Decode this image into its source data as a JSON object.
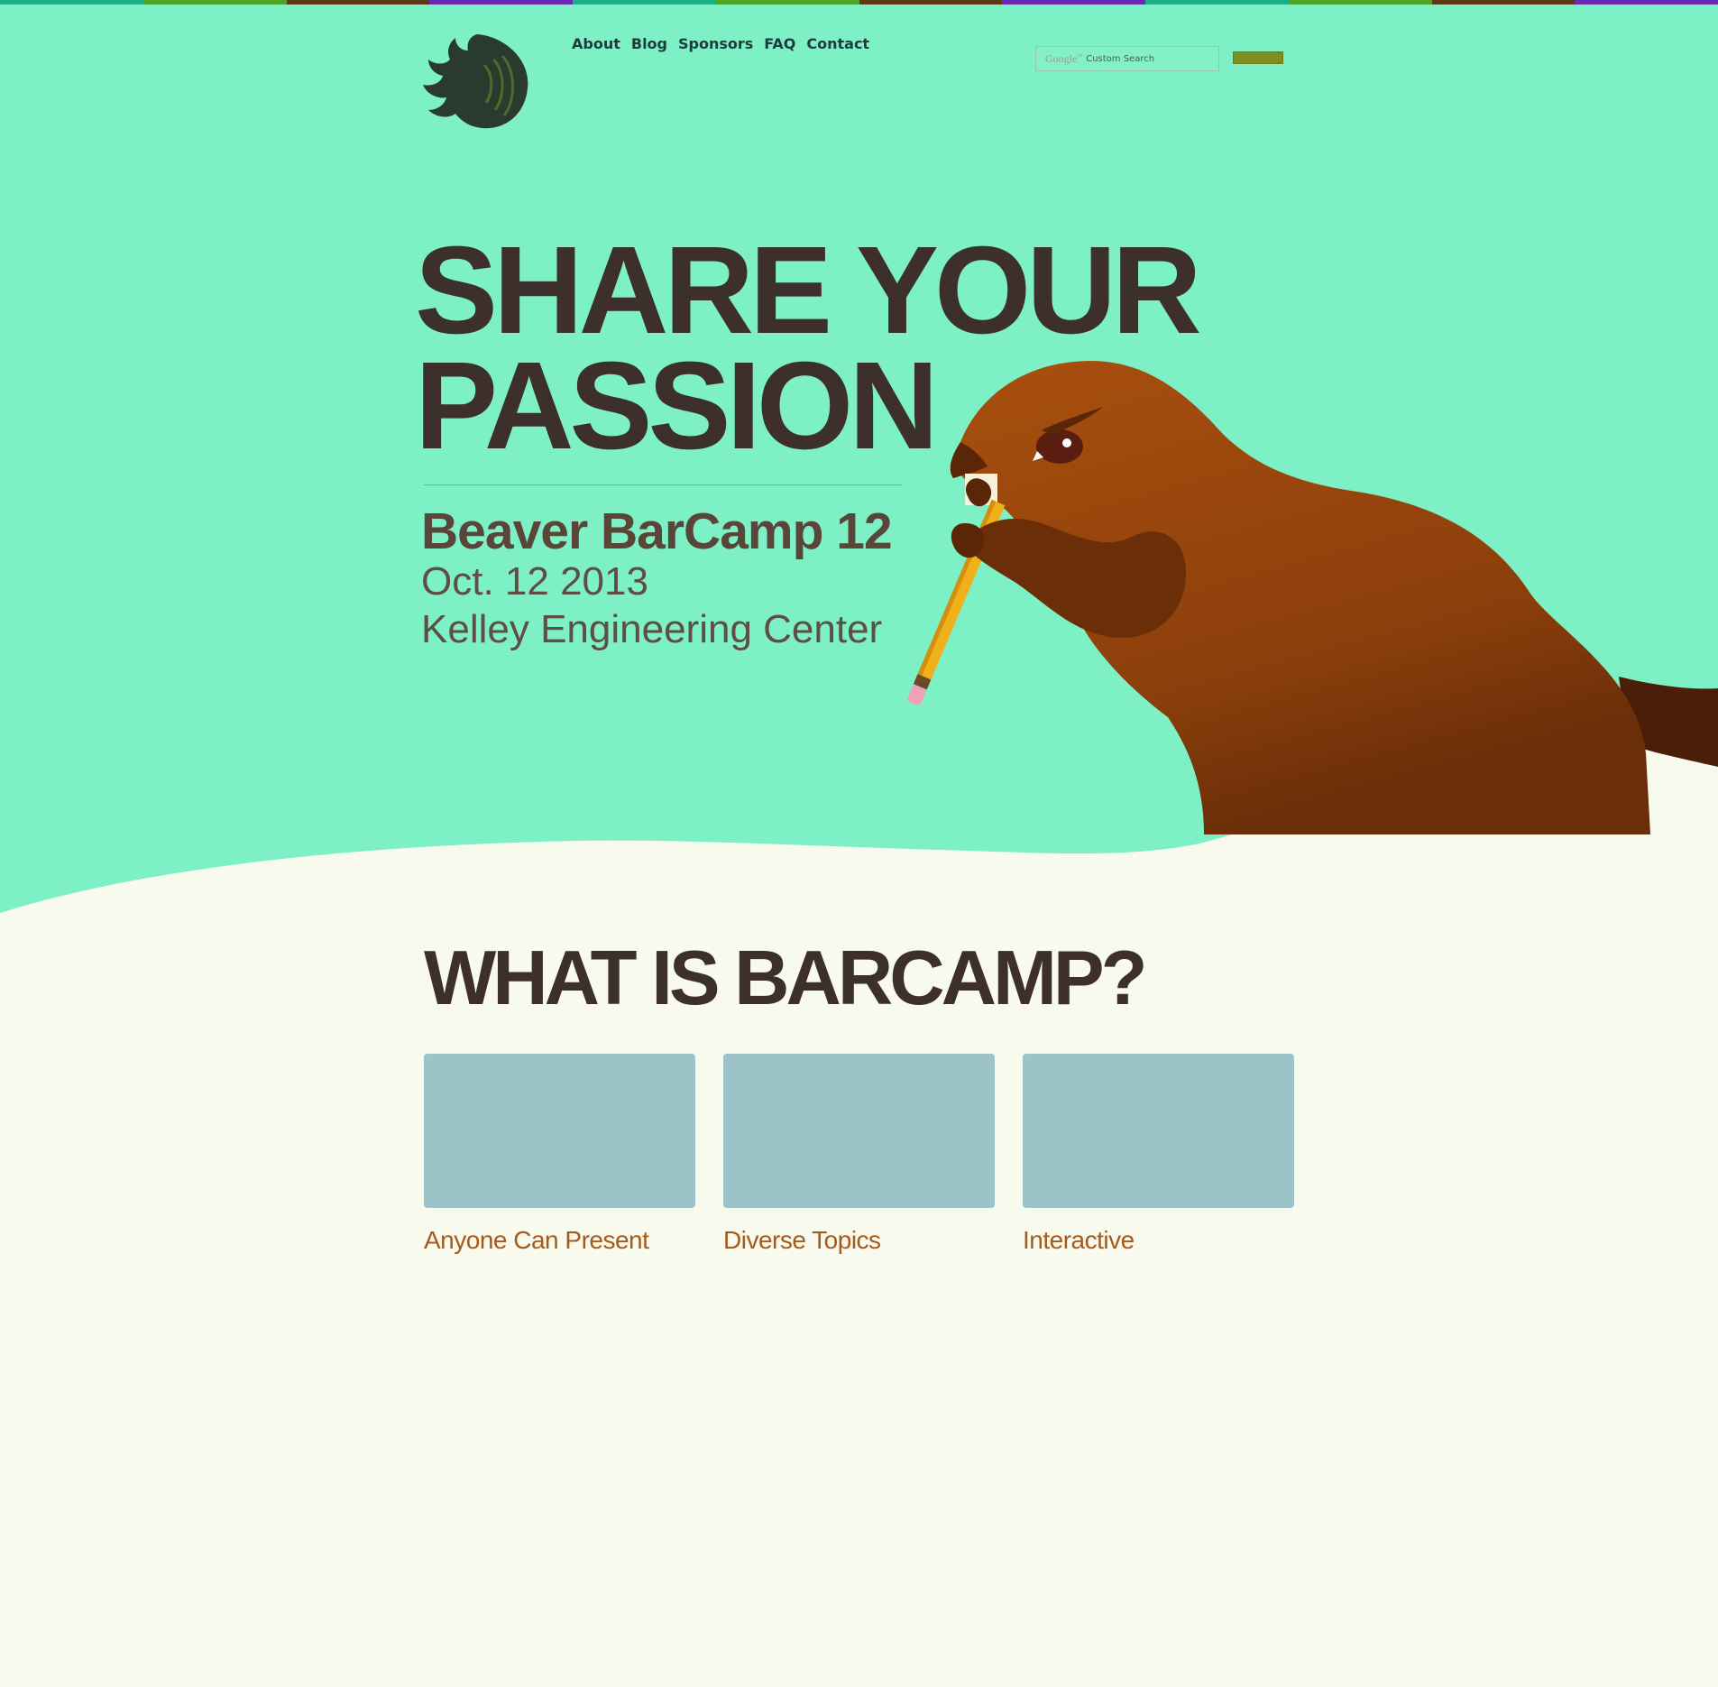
{
  "colors": {
    "hero_background": "#7ef0c5",
    "page_background": "#f9faee",
    "title_color": "#3d2f2a",
    "feature_label_color": "#a65a1c",
    "thumbnail_color": "#9cc4c8",
    "beaver_brown": "#9a4710",
    "top_strip": [
      "#1bb08a",
      "#4aa626",
      "#5a3a14",
      "#6a2bb0",
      "#1bb08a",
      "#4aa626",
      "#5a3a14",
      "#6a2bb0",
      "#1bb08a",
      "#4aa626",
      "#5a3a14",
      "#6a2bb0"
    ]
  },
  "header": {
    "logo_icon": "flame-logo-icon",
    "nav": [
      "About",
      "Blog",
      "Sponsors",
      "FAQ",
      "Contact"
    ],
    "search": {
      "brand": "Google",
      "placeholder": "Custom Search"
    }
  },
  "hero": {
    "title_line1": "SHARE YOUR",
    "title_line2": "PASSION",
    "event_name": "Beaver BarCamp 12",
    "event_date": "Oct. 12 2013",
    "event_venue": "Kelley Engineering Center",
    "illustration_icon": "beaver-with-pencil-illustration"
  },
  "what_is": {
    "title": "WHAT IS BARCAMP?",
    "features": [
      {
        "label": "Anyone Can Present"
      },
      {
        "label": "Diverse Topics"
      },
      {
        "label": "Interactive"
      }
    ]
  }
}
